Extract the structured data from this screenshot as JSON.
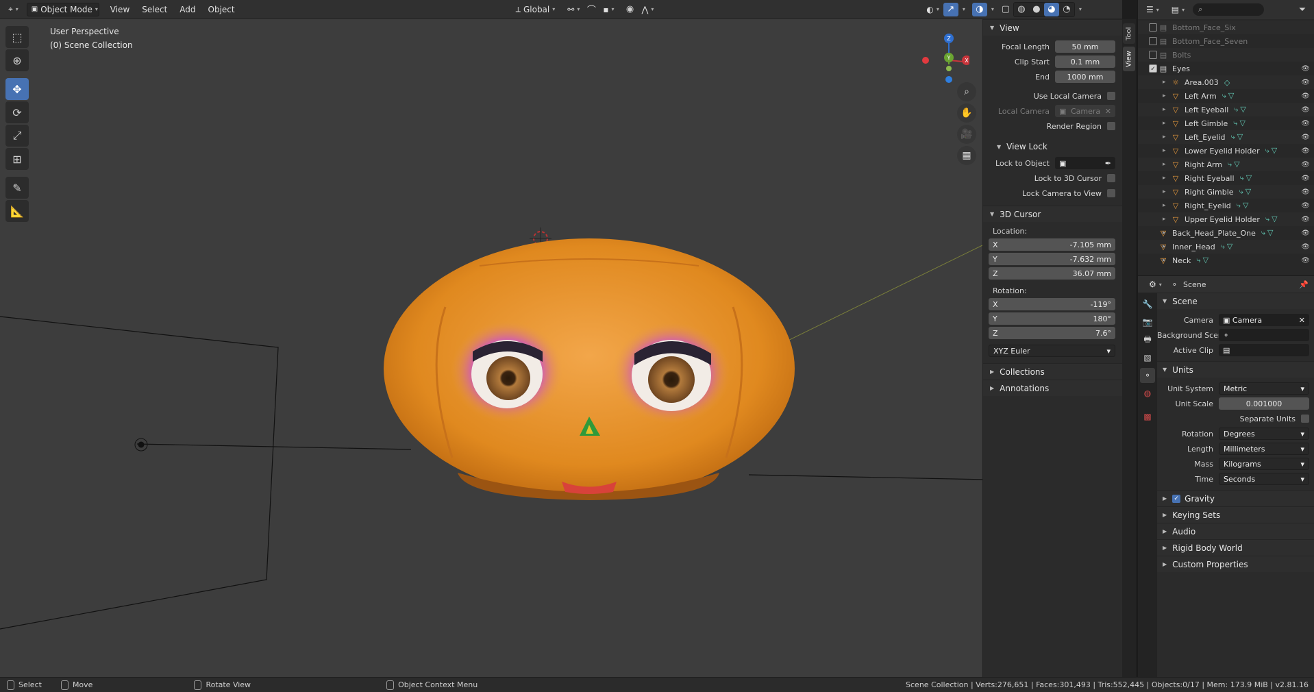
{
  "header": {
    "mode_label": "Object Mode",
    "menus": [
      "View",
      "Select",
      "Add",
      "Object"
    ],
    "orientation_label": "Global"
  },
  "viewport": {
    "perspective": "User Perspective",
    "collection": "(0) Scene Collection",
    "gizmo_axes": [
      "Z",
      "Y",
      "X"
    ]
  },
  "npanel": {
    "tabs": [
      "Tool",
      "View"
    ],
    "view": {
      "title": "View",
      "focal_length_label": "Focal Length",
      "focal_length": "50 mm",
      "clip_start_label": "Clip Start",
      "clip_start": "0.1 mm",
      "end_label": "End",
      "end": "1000 mm",
      "use_local_camera": "Use Local Camera",
      "local_camera_label": "Local Camera",
      "local_camera": "Camera",
      "render_region": "Render Region"
    },
    "view_lock": {
      "title": "View Lock",
      "lock_to_object": "Lock to Object",
      "lock_to_cursor": "Lock to 3D Cursor",
      "lock_camera": "Lock Camera to View"
    },
    "cursor": {
      "title": "3D Cursor",
      "location_label": "Location:",
      "loc": [
        {
          "axis": "X",
          "value": "-7.105 mm"
        },
        {
          "axis": "Y",
          "value": "-7.632 mm"
        },
        {
          "axis": "Z",
          "value": "36.07 mm"
        }
      ],
      "rotation_label": "Rotation:",
      "rot": [
        {
          "axis": "X",
          "value": "-119°"
        },
        {
          "axis": "Y",
          "value": "180°"
        },
        {
          "axis": "Z",
          "value": "7.6°"
        }
      ],
      "rotation_mode": "XYZ Euler"
    },
    "collections": "Collections",
    "annotations": "Annotations"
  },
  "outliner": {
    "search_placeholder": "",
    "rows": [
      {
        "label": "Bottom_Face_Six",
        "icon": "collection-icon",
        "dim": true,
        "checked": false
      },
      {
        "label": "Bottom_Face_Seven",
        "icon": "collection-icon",
        "dim": true,
        "checked": false
      },
      {
        "label": "Bolts",
        "icon": "collection-icon",
        "dim": true,
        "checked": false
      },
      {
        "label": "Eyes",
        "icon": "collection-icon",
        "dim": false,
        "checked": true
      },
      {
        "label": "Area.003",
        "icon": "light-icon",
        "dim": false,
        "checked": null
      },
      {
        "label": "Left Arm",
        "icon": "mesh-icon",
        "dim": false,
        "checked": null
      },
      {
        "label": "Left Eyeball",
        "icon": "mesh-icon",
        "dim": false,
        "checked": null
      },
      {
        "label": "Left Gimble",
        "icon": "mesh-icon",
        "dim": false,
        "checked": null
      },
      {
        "label": "Left_Eyelid",
        "icon": "mesh-icon",
        "dim": false,
        "checked": null
      },
      {
        "label": "Lower Eyelid Holder",
        "icon": "mesh-icon",
        "dim": false,
        "checked": null
      },
      {
        "label": "Right Arm",
        "icon": "mesh-icon",
        "dim": false,
        "checked": null
      },
      {
        "label": "Right Eyeball",
        "icon": "mesh-icon",
        "dim": false,
        "checked": null
      },
      {
        "label": "Right Gimble",
        "icon": "mesh-icon",
        "dim": false,
        "checked": null
      },
      {
        "label": "Right_Eyelid",
        "icon": "mesh-icon",
        "dim": false,
        "checked": null
      },
      {
        "label": "Upper Eyelid Holder",
        "icon": "mesh-icon",
        "dim": false,
        "checked": null
      },
      {
        "label": "Back_Head_Plate_One",
        "icon": "mesh-icon",
        "dim": false,
        "checked": null
      },
      {
        "label": "Inner_Head",
        "icon": "mesh-icon",
        "dim": false,
        "checked": null
      },
      {
        "label": "Neck",
        "icon": "mesh-icon",
        "dim": false,
        "checked": null
      }
    ]
  },
  "properties": {
    "context": "Scene",
    "scene_section": "Scene",
    "camera_label": "Camera",
    "camera": "Camera",
    "bg_scene_label": "Background Scene",
    "active_clip_label": "Active Clip",
    "units_section": "Units",
    "unit_system_label": "Unit System",
    "unit_system": "Metric",
    "unit_scale_label": "Unit Scale",
    "unit_scale": "0.001000",
    "separate_units": "Separate Units",
    "rotation_label": "Rotation",
    "rotation": "Degrees",
    "length_label": "Length",
    "length": "Millimeters",
    "mass_label": "Mass",
    "mass": "Kilograms",
    "time_label": "Time",
    "time": "Seconds",
    "gravity": "Gravity",
    "keying_sets": "Keying Sets",
    "audio": "Audio",
    "rigid_body": "Rigid Body World",
    "custom_props": "Custom Properties"
  },
  "statusbar": {
    "select": "Select",
    "move": "Move",
    "rotate": "Rotate View",
    "context_menu": "Object Context Menu",
    "stats": "Scene Collection | Verts:276,651 | Faces:301,493 | Tris:552,445 | Objects:0/17 | Mem: 173.9 MiB | v2.81.16"
  }
}
